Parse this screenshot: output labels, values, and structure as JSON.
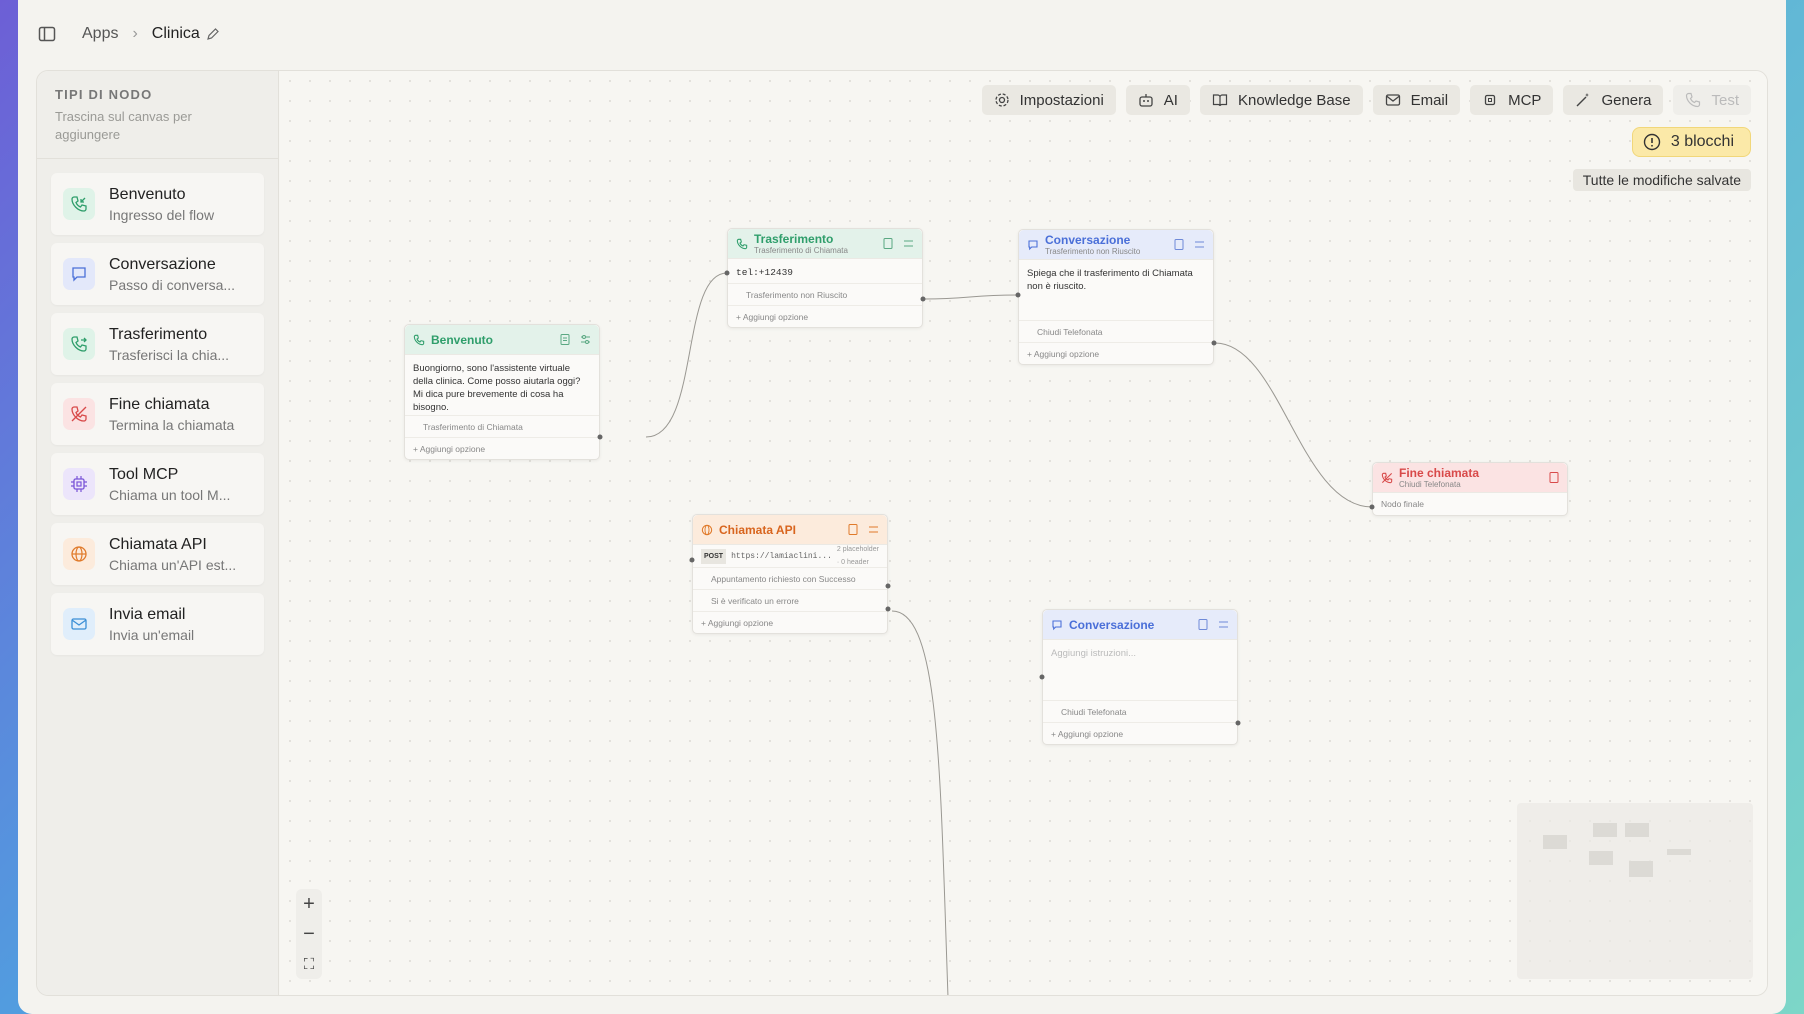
{
  "breadcrumb": {
    "root": "Apps",
    "current": "Clinica"
  },
  "sidebar": {
    "title": "TIPI DI NODO",
    "subtitle": "Trascina sul canvas per aggiungere",
    "items": [
      {
        "title": "Benvenuto",
        "subtitle": "Ingresso del flow",
        "icon": "phone-incoming-icon",
        "color": "#2f9e6b",
        "bg": "#dff3e8"
      },
      {
        "title": "Conversazione",
        "subtitle": "Passo di conversa...",
        "icon": "chat-icon",
        "color": "#4a6fd8",
        "bg": "#e3e8fa"
      },
      {
        "title": "Trasferimento",
        "subtitle": "Trasferisci la chia...",
        "icon": "phone-forward-icon",
        "color": "#2f9e6b",
        "bg": "#dff3e8"
      },
      {
        "title": "Fine chiamata",
        "subtitle": "Termina la chiamata",
        "icon": "phone-off-icon",
        "color": "#d84a4a",
        "bg": "#fbe3e3"
      },
      {
        "title": "Tool MCP",
        "subtitle": "Chiama un tool M...",
        "icon": "cpu-icon",
        "color": "#7a55d8",
        "bg": "#ece5fb"
      },
      {
        "title": "Chiamata API",
        "subtitle": "Chiama un'API est...",
        "icon": "globe-icon",
        "color": "#e07a2a",
        "bg": "#fcebdc"
      },
      {
        "title": "Invia email",
        "subtitle": "Invia un'email",
        "icon": "mail-icon",
        "color": "#3b8fd6",
        "bg": "#e0eefb"
      }
    ]
  },
  "toolbar": {
    "settings": "Impostazioni",
    "ai": "AI",
    "knowledge": "Knowledge Base",
    "email": "Email",
    "mcp": "MCP",
    "generate": "Genera",
    "test": "Test"
  },
  "status": {
    "blocks": "3 blocchi",
    "saved": "Tutte le modifiche salvate"
  },
  "nodes": {
    "benvenuto": {
      "title": "Benvenuto",
      "body": "Buongiorno, sono l'assistente virtuale della clinica. Come posso aiutarla oggi? Mi dica pure brevemente di cosa ha bisogno.",
      "option": "Trasferimento di Chiamata",
      "add": "+ Aggiungi opzione"
    },
    "trasferimento": {
      "title": "Trasferimento",
      "subtitle": "Trasferimento di Chiamata",
      "body": "tel:+12439",
      "option": "Trasferimento non Riuscito",
      "add": "+ Aggiungi opzione"
    },
    "conversazione1": {
      "title": "Conversazione",
      "subtitle": "Trasferimento non Riuscito",
      "body": "Spiega che il trasferimento di Chiamata non è riuscito.",
      "option": "Chiudi Telefonata",
      "add": "+ Aggiungi opzione"
    },
    "fine": {
      "title": "Fine chiamata",
      "subtitle": "Chiudi Telefonata",
      "body": "Nodo finale"
    },
    "api": {
      "title": "Chiamata API",
      "method": "POST",
      "url": "https://lamiaclini...",
      "meta": "2 placeholder · 0 header",
      "option1": "Appuntamento richiesto con Successo",
      "option2": "Si è verificato un errore",
      "add": "+ Aggiungi opzione"
    },
    "conversazione2": {
      "title": "Conversazione",
      "placeholder": "Aggiungi istruzioni...",
      "option": "Chiudi Telefonata",
      "add": "+ Aggiungi opzione"
    }
  },
  "zoom": {
    "in": "+",
    "out": "−",
    "fit": "⛶"
  }
}
